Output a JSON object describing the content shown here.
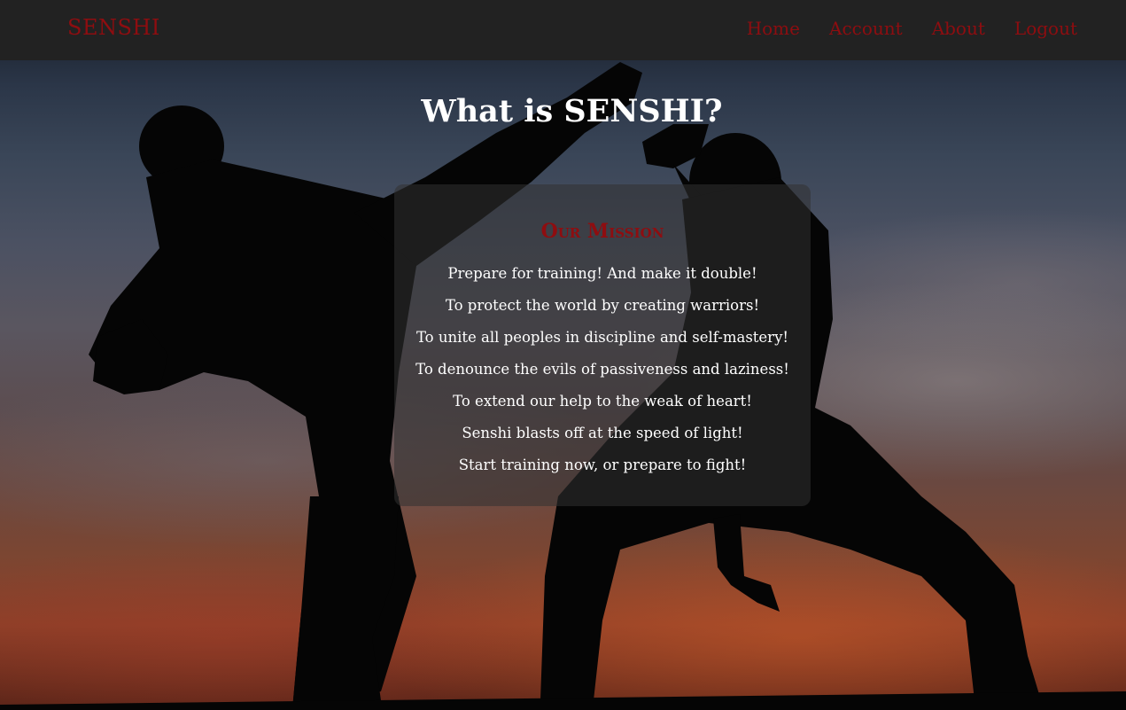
{
  "nav": {
    "brand": "SENSHI",
    "links": [
      {
        "label": "Home"
      },
      {
        "label": "Account"
      },
      {
        "label": "About"
      },
      {
        "label": "Logout"
      }
    ]
  },
  "main": {
    "title": "What is SENSHI?",
    "mission": {
      "heading": "Our Mission",
      "lines": [
        "Prepare for training! And make it double!",
        "To protect the world by creating warriors!",
        "To unite all peoples in discipline and self-mastery!",
        "To denounce the evils of passiveness and laziness!",
        "To extend our help to the weak of heart!",
        "Senshi blasts off at the speed of light!",
        "Start training now, or prepare to fight!"
      ]
    }
  },
  "colors": {
    "navbar_bg": "#222222",
    "accent_red": "#8e0d10",
    "text_white": "#ffffff"
  },
  "background_image": "two martial artists sparring in silhouette against sunset sky"
}
